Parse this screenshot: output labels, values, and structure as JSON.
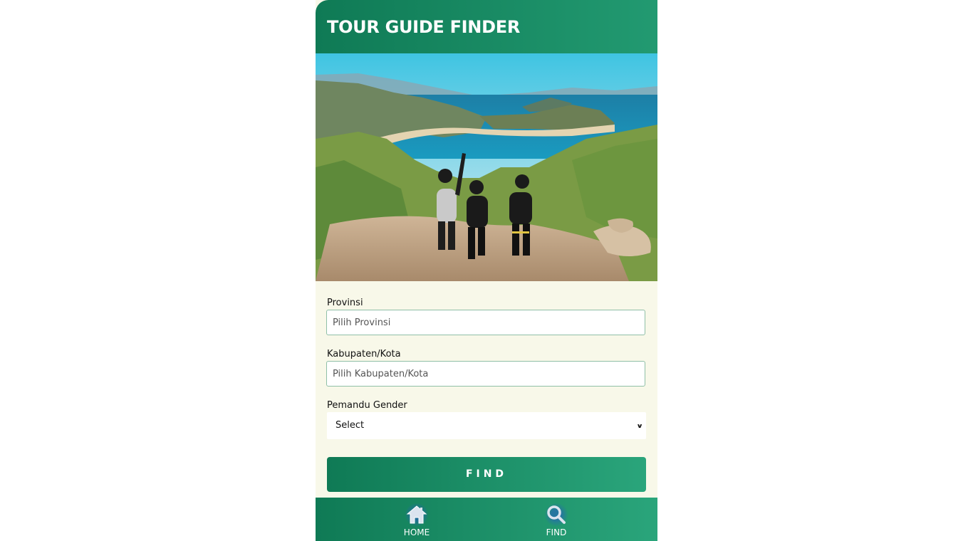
{
  "header": {
    "title": "TOUR GUIDE FINDER"
  },
  "hero": {
    "description": "coastal-landscape-with-three-hikers"
  },
  "form": {
    "province_label": "Provinsi",
    "province_placeholder": "Pilih Provinsi",
    "city_label": "Kabupaten/Kota",
    "city_placeholder": "Pilih Kabupaten/Kota",
    "gender_label": "Pemandu Gender",
    "gender_value": "Select",
    "find_label": "FIND"
  },
  "nav": {
    "home_label": "HOME",
    "find_label": "FIND",
    "home_icon": "home-icon",
    "find_icon": "search-icon"
  },
  "colors": {
    "primary": "#0f7a55",
    "primary_light": "#2aa57b",
    "background": "#f8f8e9"
  }
}
